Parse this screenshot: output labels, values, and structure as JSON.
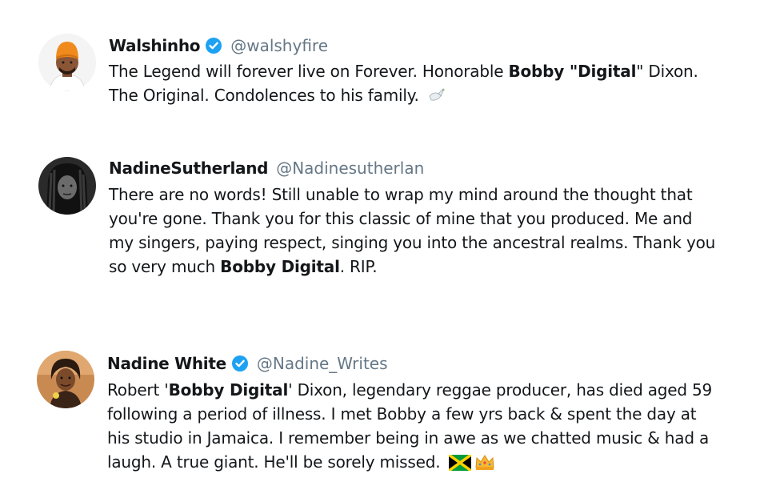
{
  "tweets": [
    {
      "name": "Walshinho",
      "handle": "@walshyfire",
      "verified": true,
      "line1_a": "The Legend will forever live on Forever. Honorable ",
      "line1_b": "Bobby \"Digital",
      "line1_c": "\" Dixon.",
      "line2": "The Original. Condolences to his family. ",
      "emoji": "dove-emoji"
    },
    {
      "name": "NadineSutherland",
      "handle": "@Nadinesutherlan",
      "verified": false,
      "line1": "There are no words! Still unable to wrap my mind around the thought that",
      "line2": "you're gone. Thank you for this classic of mine that you produced. Me and",
      "line3": "my singers, paying respect, singing you into the ancestral realms. Thank you",
      "line4_a": "so very much ",
      "line4_b": "Bobby Digital",
      "line4_c": ". RIP."
    },
    {
      "name": "Nadine White",
      "handle": "@Nadine_Writes",
      "verified": true,
      "line1_a": "Robert '",
      "line1_b": "Bobby Digital",
      "line1_c": "' Dixon, legendary reggae producer, has died aged 59",
      "line2": "following a period of illness. I met Bobby a few yrs back & spent the day at",
      "line3": "his studio in Jamaica. I remember being in awe as we chatted music & had a",
      "line4": "laugh. A true giant. He'll be sorely missed. ",
      "emojis": [
        "jamaica-flag-emoji",
        "crown-emoji"
      ]
    }
  ],
  "colors": {
    "verified": "#1da1f2",
    "handle": "#657786",
    "text": "#14171a"
  }
}
